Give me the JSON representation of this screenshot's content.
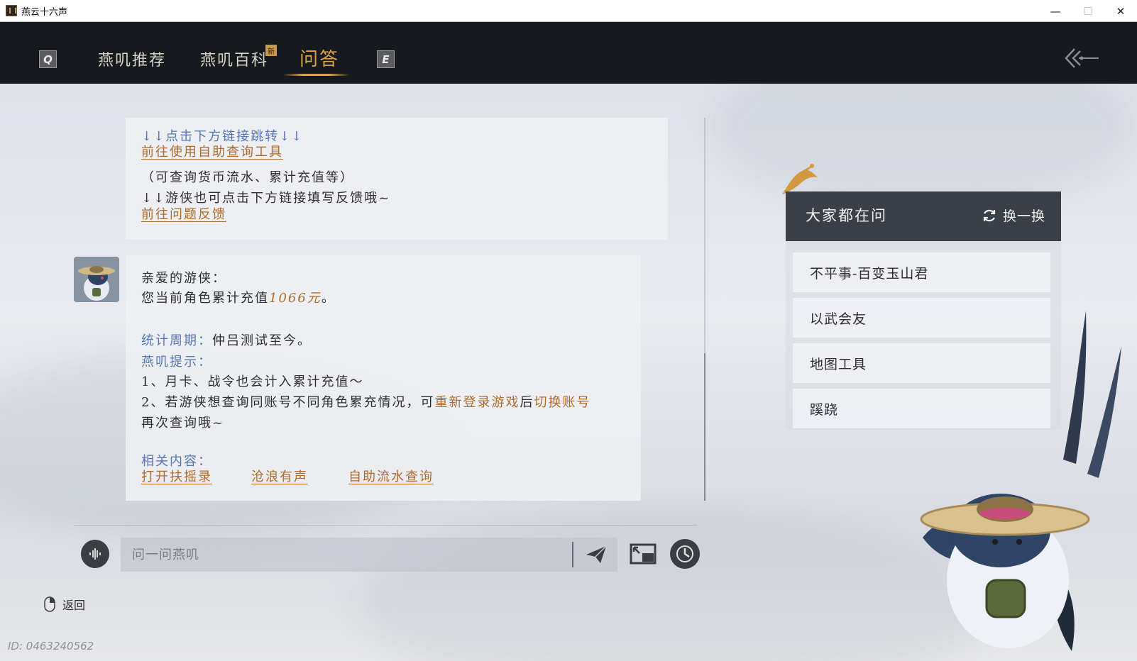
{
  "window": {
    "title": "燕云十六声",
    "minimize": "—",
    "maximize": "☐",
    "close": "✕"
  },
  "nav": {
    "left_key": "Q",
    "right_key": "E",
    "tabs": [
      "燕叽推荐",
      "燕叽百科",
      "问答"
    ],
    "new_badge": "新",
    "active_tab": "问答"
  },
  "chat": {
    "message1": {
      "hint_top": "↓↓点击下方链接跳转↓↓",
      "link_self_query": "前往使用自助查询工具",
      "note": "（可查询货币流水、累计充值等）",
      "hint_feedback": "↓↓游侠也可点击下方链接填写反馈哦~",
      "link_feedback": "前往问题反馈"
    },
    "message2": {
      "greeting": "亲爱的游侠：",
      "total_prefix": "您当前角色累计充值",
      "total_amount": "1066元",
      "total_suffix": "。",
      "period_label": "统计周期：",
      "period_value": "仲吕测试至今。",
      "tips_label": "燕叽提示：",
      "tip1": "1、月卡、战令也会计入累计充值～",
      "tip2_a": "2、若游侠想查询同账号不同角色累充情况，可",
      "tip2_link1": "重新登录游戏",
      "tip2_b": "后",
      "tip2_link2": "切换账号",
      "tip2_c": "再次查询哦~",
      "related_label": "相关内容：",
      "related_links": [
        "打开扶摇录",
        "沧浪有声",
        "自助流水查询"
      ]
    }
  },
  "input": {
    "placeholder": "问一问燕叽"
  },
  "footer": {
    "return_label": "返回",
    "uid": "ID: 0463240562"
  },
  "faq": {
    "title": "大家都在问",
    "refresh_label": "换一换",
    "items": [
      "不平事-百变玉山君",
      "以武会友",
      "地图工具",
      "蹊跷"
    ]
  },
  "colors": {
    "accent_gold": "#d9a447",
    "link_orange": "#b06a2c",
    "label_blue": "#5877b5",
    "nav_bg": "#16191d"
  }
}
